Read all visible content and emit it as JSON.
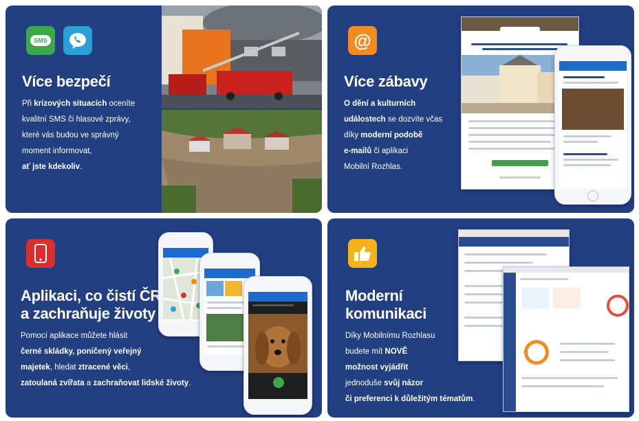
{
  "colors": {
    "card_bg": "#223f82",
    "sms_green": "#3aa84b",
    "viber_blue": "#29a1d8",
    "email_orange": "#f28c1e",
    "phone_red": "#d9302f",
    "like_yellow": "#f5b21a"
  },
  "icons": {
    "sms": "SMS",
    "viber": "phone-bubble-icon",
    "at": "@",
    "phone": "smartphone-icon",
    "like": "thumbs-up-icon"
  },
  "panel1": {
    "title": "Více bezpečí",
    "body": [
      [
        {
          "t": "Při "
        },
        {
          "t": "krizových situacích",
          "b": true
        },
        {
          "t": " oceníte"
        }
      ],
      [
        {
          "t": "kvalitní SMS či hlasové zprávy,"
        }
      ],
      [
        {
          "t": "které vás budou ve správný"
        }
      ],
      [
        {
          "t": "moment informovat,"
        }
      ],
      [
        {
          "t": "ať jste kdekoliv",
          "b": true
        },
        {
          "t": "."
        }
      ]
    ]
  },
  "panel2": {
    "title": "Více zábavy",
    "body": [
      [
        {
          "t": "O dění a kulturních",
          "b": true
        }
      ],
      [
        {
          "t": "událostech",
          "b": true
        },
        {
          "t": " se dozvíte včas"
        }
      ],
      [
        {
          "t": "díky "
        },
        {
          "t": "moderní podobě",
          "b": true
        }
      ],
      [
        {
          "t": "e-mailů",
          "b": true
        },
        {
          "t": " či aplikaci"
        }
      ],
      [
        {
          "t": "Mobilní Rozhlas."
        }
      ]
    ]
  },
  "panel3": {
    "title_lines": [
      "Aplikaci, co čistí ČR",
      "a zachraňuje životy"
    ],
    "body": [
      [
        {
          "t": "Pomocí aplikace můžete hlásit"
        }
      ],
      [
        {
          "t": "černé skládky, poničený veřejný",
          "b": true
        }
      ],
      [
        {
          "t": "majetek",
          "b": true
        },
        {
          "t": ", hledat "
        },
        {
          "t": "ztracené věci",
          "b": true
        },
        {
          "t": ","
        }
      ],
      [
        {
          "t": "zatoulaná zvířata",
          "b": true
        },
        {
          "t": " a "
        },
        {
          "t": "zachraňovat lidské životy",
          "b": true
        },
        {
          "t": "."
        }
      ]
    ]
  },
  "panel4": {
    "title_lines": [
      "Moderní",
      "komunikaci"
    ],
    "body": [
      [
        {
          "t": "Díky Mobilnímu Rozhlasu"
        }
      ],
      [
        {
          "t": "budete mít  "
        },
        {
          "t": "NOVĚ",
          "b": true
        }
      ],
      [
        {
          "t": "možnost vyjádřit",
          "b": true
        }
      ],
      [
        {
          "t": "jednoduše "
        },
        {
          "t": "svůj názor",
          "b": true
        }
      ],
      [
        {
          "t": "či preferenci k důležitým tématům",
          "b": true
        },
        {
          "t": "."
        }
      ]
    ]
  }
}
